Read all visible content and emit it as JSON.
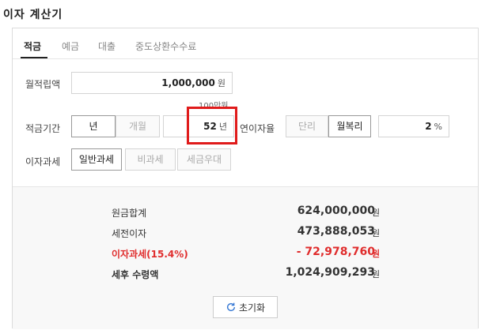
{
  "title": "이자 계산기",
  "tabs": [
    {
      "label": "적금"
    },
    {
      "label": "예금"
    },
    {
      "label": "대출"
    },
    {
      "label": "중도상환수수료"
    }
  ],
  "monthly": {
    "label": "월적립액",
    "value": "1,000,000",
    "unit": "원",
    "hint": "100만원"
  },
  "period": {
    "label": "적금기간",
    "unit_year": "년",
    "unit_month": "개월",
    "value": "52",
    "value_unit": "년"
  },
  "rate": {
    "label": "연이자율",
    "simple": "단리",
    "compound": "월복리",
    "value": "2",
    "unit": "%"
  },
  "tax": {
    "label": "이자과세",
    "options": [
      "일반과세",
      "비과세",
      "세금우대"
    ]
  },
  "results": [
    {
      "label": "원금합계",
      "value": "624,000,000",
      "unit": "원"
    },
    {
      "label": "세전이자",
      "value": "473,888,053",
      "unit": "원"
    },
    {
      "label": "이자과세(15.4%)",
      "value": "- 72,978,760",
      "unit": "원"
    },
    {
      "label": "세후 수령액",
      "value": "1,024,909,293",
      "unit": "원"
    }
  ],
  "reset_label": "초기화",
  "colors": {
    "accent_red": "#e02d2d",
    "highlight": "#e01b1b"
  },
  "icons": {
    "reset": "refresh-icon"
  }
}
